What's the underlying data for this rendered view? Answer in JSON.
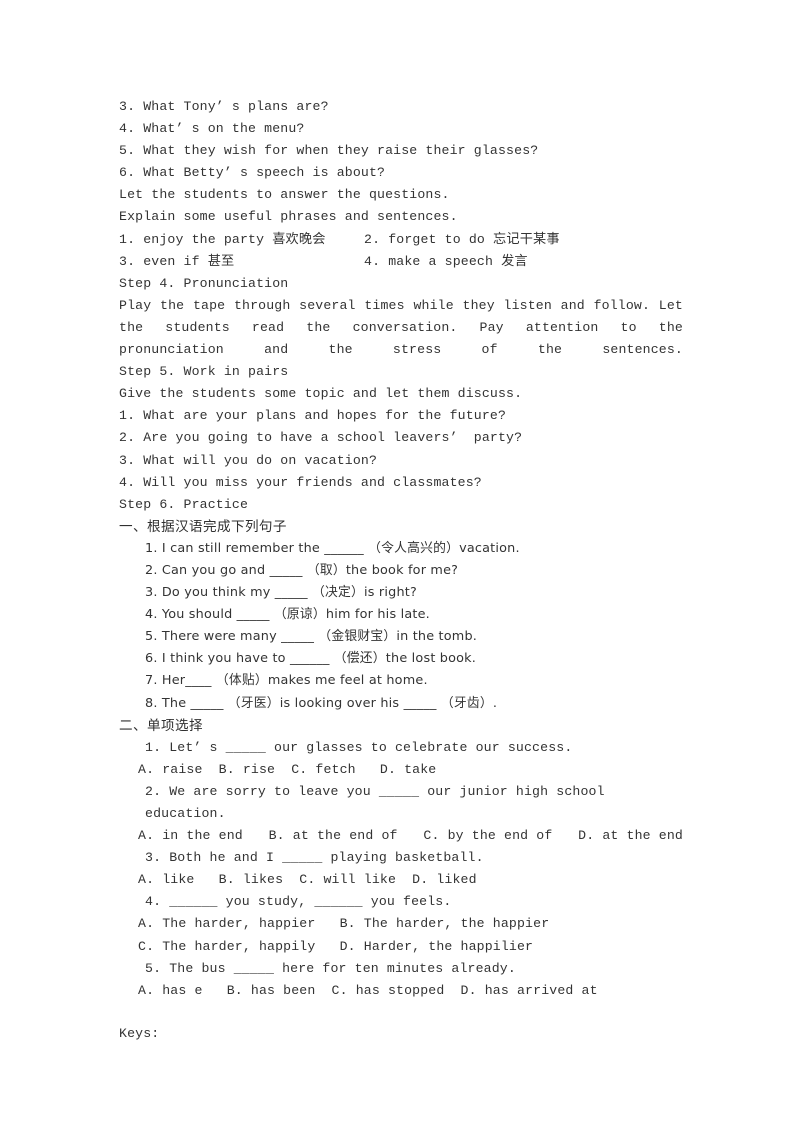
{
  "document": {
    "kind": "teaching-plan-worksheet",
    "listening_questions": [
      "3. What Tony’ s plans are?",
      "4. What’ s on the menu?",
      "5. What they wish for when they raise their glasses?",
      "6. What Betty’ s speech is about?"
    ],
    "instruction_lines": [
      "Let the students to answer the questions.",
      "Explain some useful phrases and sentences."
    ],
    "phrases": [
      {
        "left": "1. enjoy the party 喜欢晚会",
        "right": "2. forget to do 忘记干某事"
      },
      {
        "left": "3. even if 甚至",
        "right": "4. make a speech 发言"
      }
    ],
    "step4": {
      "heading": "Step 4. Pronunciation",
      "paragraph": "Play the tape through several times while they listen and follow. Let the students read the conversation. Pay attention to the pronunciation and the stress of the sentences."
    },
    "step5": {
      "heading": "Step 5. Work in pairs",
      "intro": "Give the students some topic and let them discuss.",
      "questions": [
        "1. What are your plans and hopes for the future?",
        "2. Are you going to have a school leavers’  party?",
        "3. What will you do on vacation?",
        "4. Will you miss your friends and classmates?"
      ]
    },
    "step6": {
      "heading": "Step 6. Practice",
      "section_one": {
        "title": "一、根据汉语完成下列句子",
        "items": [
          "1. I can still remember the ______ （令人高兴的）vacation.",
          "2. Can you go and _____ （取）the book for me?",
          "3. Do you think my _____ （决定）is right?",
          "4. You should _____ （原谅）him for his late.",
          "5. There were many _____ （金银财宝）in the tomb.",
          "6. I think you have to ______ （偿还）the lost book.",
          "7. Her____ （体贴）makes me feel at home.",
          "8. The _____ （牙医）is looking over his _____ （牙齿）."
        ]
      },
      "section_two": {
        "title": "二、单项选择",
        "questions": [
          {
            "stem": "1. Let’ s _____ our glasses to celebrate our success.",
            "options_line": "A. raise  B. rise  C. fetch   D. take",
            "options": [
              "A. raise",
              "B. rise",
              "C. fetch",
              "D. take"
            ],
            "spread": false
          },
          {
            "stem": "2. We are sorry to leave you _____ our junior high school education.",
            "options_line": "A. in the end    B. at the end of   C. by the end of   D. at the end",
            "options": [
              "A. in the end",
              "B. at the end of",
              "C. by the end of",
              "D. at the end"
            ],
            "spread": true
          },
          {
            "stem": "3. Both he and I _____ playing basketball.",
            "options_line": "A. like   B. likes  C. will like  D. liked",
            "options": [
              "A. like",
              "B. likes",
              "C. will like",
              "D. liked"
            ],
            "spread": false
          },
          {
            "stem": "4. ______ you study, ______ you feels.",
            "options_line": "A. The harder, happier   B. The harder, the happier",
            "options_line2": "C. The harder, happily   D. Harder, the happilier",
            "options": [
              "A. The harder, happier",
              "B. The harder, the happier",
              "C. The harder, happily",
              "D. Harder, the happilier"
            ],
            "spread": false
          },
          {
            "stem": "5. The bus _____ here for ten minutes already.",
            "options_line": "A. has e   B. has been  C. has stopped  D. has arrived at",
            "options": [
              "A. has e",
              "B. has been",
              "C. has stopped",
              "D. has arrived at"
            ],
            "spread": false
          }
        ]
      }
    },
    "keys_label": "Keys:"
  }
}
